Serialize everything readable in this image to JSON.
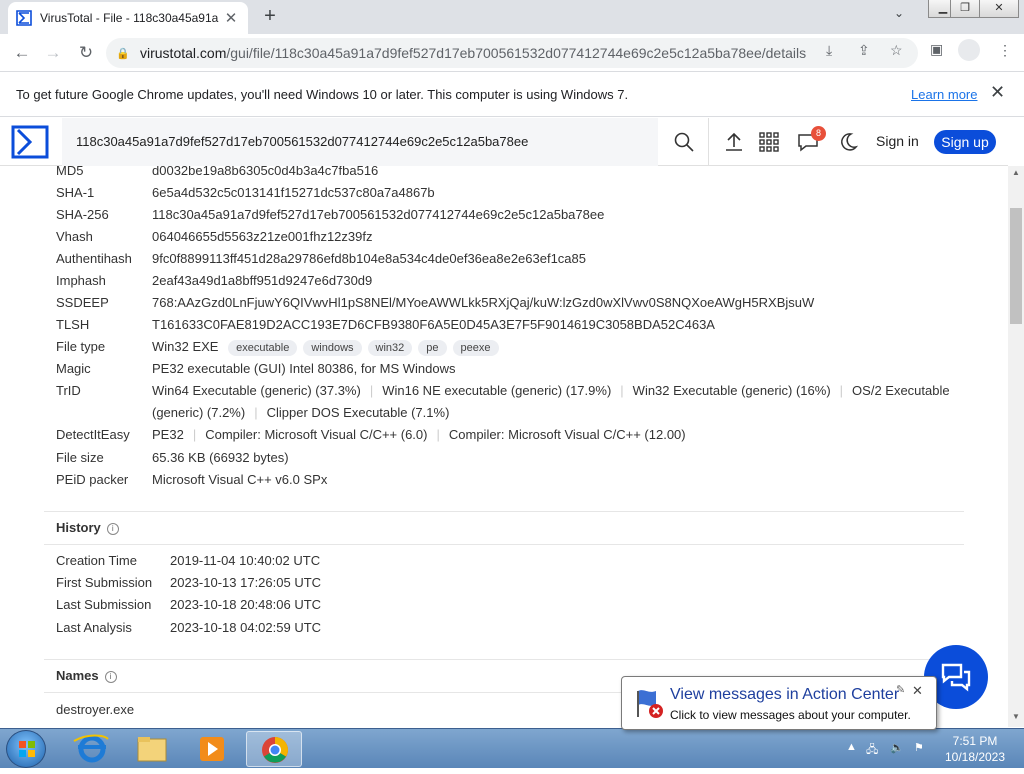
{
  "browser": {
    "tab_title": "VirusTotal - File - 118c30a45a91a",
    "url_host": "virustotal.com",
    "url_path": "/gui/file/118c30a45a91a7d9fef527d17eb700561532d077412744e69c2e5c12a5ba78ee/details",
    "infobar_message": "To get future Google Chrome updates, you'll need Windows 10 or later. This computer is using Windows 7.",
    "infobar_link": "Learn more"
  },
  "header": {
    "search_value": "118c30a45a91a7d9fef527d17eb700561532d077412744e69c2e5c12a5ba78ee",
    "notification_count": "8",
    "sign_in": "Sign in",
    "sign_up": "Sign up"
  },
  "basic": [
    {
      "k": "MD5",
      "v": "d0032be19a8b6305c0d4b3a4c7fba516"
    },
    {
      "k": "SHA-1",
      "v": "6e5a4d532c5c013141f15271dc537c80a7a4867b"
    },
    {
      "k": "SHA-256",
      "v": "118c30a45a91a7d9fef527d17eb700561532d077412744e69c2e5c12a5ba78ee"
    },
    {
      "k": "Vhash",
      "v": "064046655d5563z21ze001fhz12z39fz"
    },
    {
      "k": "Authentihash",
      "v": "9fc0f8899113ff451d28a29786efd8b104e8a534c4de0ef36ea8e2e63ef1ca85"
    },
    {
      "k": "Imphash",
      "v": "2eaf43a49d1a8bff951d9247e6d730d9"
    },
    {
      "k": "SSDEEP",
      "v": "768:AAzGzd0LnFjuwY6QIVwvHl1pS8NEl/MYoeAWWLkk5RXjQaj/kuW:lzGzd0wXlVwv0S8NQXoeAWgH5RXBjsuW"
    },
    {
      "k": "TLSH",
      "v": "T161633C0FAE819D2ACC193E7D6CFB9380F6A5E0D45A3E7F5F9014619C3058BDA52C463A"
    }
  ],
  "file_type": {
    "k": "File type",
    "v": "Win32 EXE",
    "tags": [
      "executable",
      "windows",
      "win32",
      "pe",
      "peexe"
    ]
  },
  "magic": {
    "k": "Magic",
    "v": "PE32 executable (GUI) Intel 80386, for MS Windows"
  },
  "trid": {
    "k": "TrID",
    "line1": [
      "Win64 Executable (generic) (37.3%)",
      "Win16 NE executable (generic) (17.9%)",
      "Win32 Executable (generic) (16%)",
      "OS/2 Executable"
    ],
    "line2": [
      "(generic) (7.2%)",
      "Clipper DOS Executable (7.1%)"
    ]
  },
  "detect": {
    "k": "DetectItEasy",
    "items": [
      "PE32",
      "Compiler: Microsoft Visual C/C++ (6.0)",
      "Compiler: Microsoft Visual C/C++ (12.00)"
    ]
  },
  "file_size": {
    "k": "File size",
    "v": "65.36 KB (66932 bytes)"
  },
  "peid": {
    "k": "PEiD packer",
    "v": "Microsoft Visual C++ v6.0 SPx"
  },
  "history": {
    "title": "History",
    "rows": [
      {
        "k": "Creation Time",
        "v": "2019-11-04 10:40:02 UTC"
      },
      {
        "k": "First Submission",
        "v": "2023-10-13 17:26:05 UTC"
      },
      {
        "k": "Last Submission",
        "v": "2023-10-18 20:48:06 UTC"
      },
      {
        "k": "Last Analysis",
        "v": "2023-10-18 04:02:59 UTC"
      }
    ]
  },
  "names": {
    "title": "Names",
    "first": "destroyer.exe"
  },
  "balloon": {
    "title": "View messages in Action Center",
    "body": "Click to view messages about your computer."
  },
  "taskbar": {
    "time": "7:51 PM",
    "date": "10/18/2023"
  },
  "colors": {
    "vt_blue": "#0b4dda",
    "chrome_accent": "#1a73e8"
  }
}
